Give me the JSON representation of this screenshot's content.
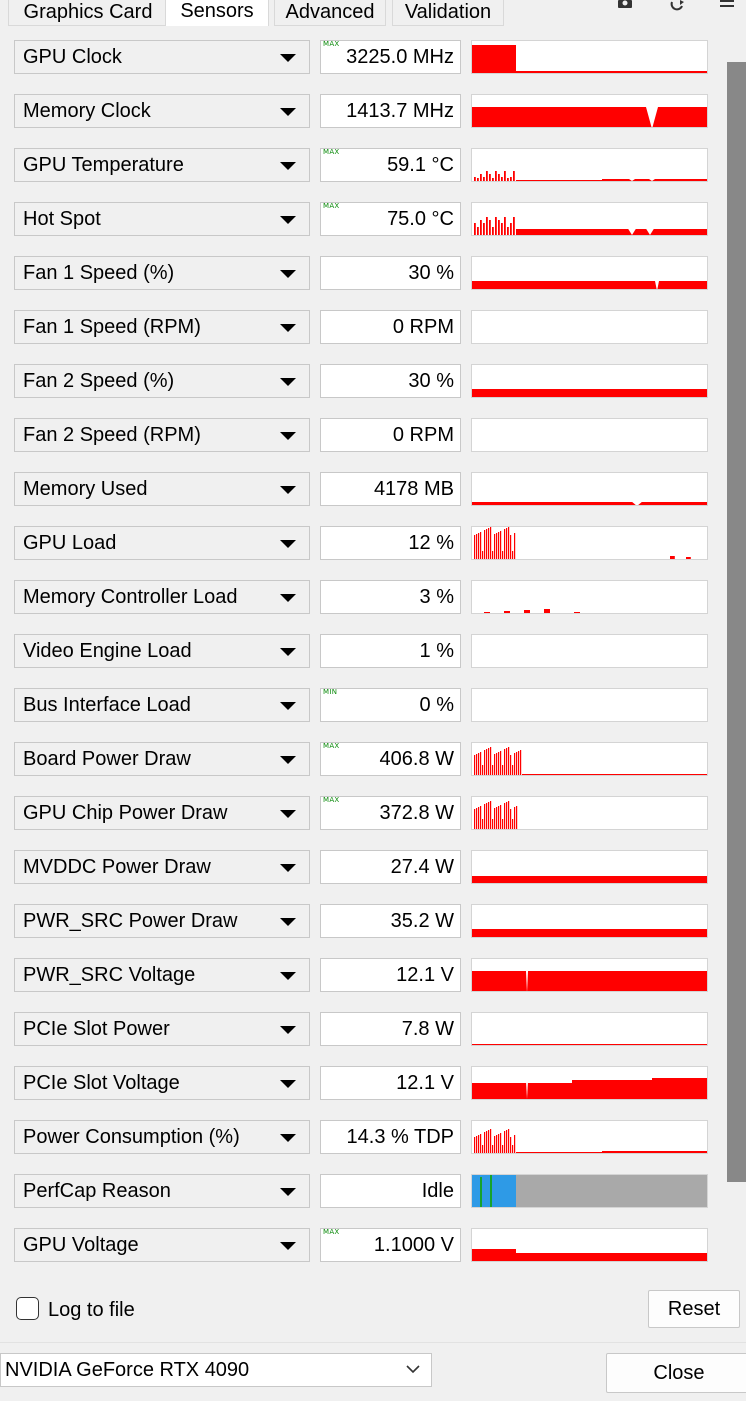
{
  "tabs": [
    "Graphics Card",
    "Sensors",
    "Advanced",
    "Validation"
  ],
  "active_tab": "Sensors",
  "toolbar_icons": [
    "camera-icon",
    "refresh-icon",
    "menu-icon"
  ],
  "sensors": [
    {
      "label": "GPU Clock",
      "value": "3225.0 MHz",
      "badge": "MAX"
    },
    {
      "label": "Memory Clock",
      "value": "1413.7 MHz",
      "badge": ""
    },
    {
      "label": "GPU Temperature",
      "value": "59.1 °C",
      "badge": "MAX"
    },
    {
      "label": "Hot Spot",
      "value": "75.0 °C",
      "badge": "MAX"
    },
    {
      "label": "Fan 1 Speed (%)",
      "value": "30 %",
      "badge": ""
    },
    {
      "label": "Fan 1 Speed (RPM)",
      "value": "0 RPM",
      "badge": ""
    },
    {
      "label": "Fan 2 Speed (%)",
      "value": "30 %",
      "badge": ""
    },
    {
      "label": "Fan 2 Speed (RPM)",
      "value": "0 RPM",
      "badge": ""
    },
    {
      "label": "Memory Used",
      "value": "4178 MB",
      "badge": ""
    },
    {
      "label": "GPU Load",
      "value": "12 %",
      "badge": ""
    },
    {
      "label": "Memory Controller Load",
      "value": "3 %",
      "badge": ""
    },
    {
      "label": "Video Engine Load",
      "value": "1 %",
      "badge": ""
    },
    {
      "label": "Bus Interface Load",
      "value": "0 %",
      "badge": "MIN"
    },
    {
      "label": "Board Power Draw",
      "value": "406.8 W",
      "badge": "MAX"
    },
    {
      "label": "GPU Chip Power Draw",
      "value": "372.8 W",
      "badge": "MAX"
    },
    {
      "label": "MVDDC Power Draw",
      "value": "27.4 W",
      "badge": ""
    },
    {
      "label": "PWR_SRC Power Draw",
      "value": "35.2 W",
      "badge": ""
    },
    {
      "label": "PWR_SRC Voltage",
      "value": "12.1 V",
      "badge": ""
    },
    {
      "label": "PCIe Slot Power",
      "value": "7.8 W",
      "badge": ""
    },
    {
      "label": "PCIe Slot Voltage",
      "value": "12.1 V",
      "badge": ""
    },
    {
      "label": "Power Consumption (%)",
      "value": "14.3 % TDP",
      "badge": ""
    },
    {
      "label": "PerfCap Reason",
      "value": "Idle",
      "badge": ""
    },
    {
      "label": "GPU Voltage",
      "value": "1.1000 V",
      "badge": "MAX"
    }
  ],
  "graph_colors": {
    "line": "#ff0000",
    "perfcap_idle": "#a9a9a9",
    "perfcap_blue": "#2e9ae6",
    "perfcap_green": "#17a32c"
  },
  "log_to_file_label": "Log to file",
  "log_to_file_checked": false,
  "reset_label": "Reset",
  "gpu_select_value": "NVIDIA GeForce RTX 4090",
  "close_label": "Close"
}
